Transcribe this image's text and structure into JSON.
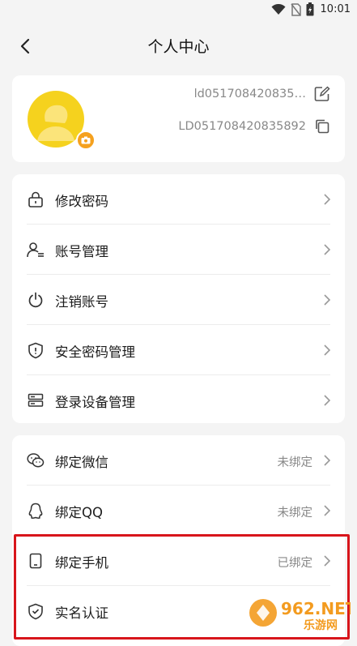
{
  "status": {
    "time": "10:01"
  },
  "header": {
    "title": "个人中心"
  },
  "profile": {
    "username": "ld051708420835…",
    "user_id": "LD051708420835892"
  },
  "menu1": [
    {
      "label": "修改密码",
      "icon": "lock-icon"
    },
    {
      "label": "账号管理",
      "icon": "user-manage-icon"
    },
    {
      "label": "注销账号",
      "icon": "power-icon"
    },
    {
      "label": "安全密码管理",
      "icon": "shield-icon"
    },
    {
      "label": "登录设备管理",
      "icon": "device-icon"
    }
  ],
  "menu2": [
    {
      "label": "绑定微信",
      "value": "未绑定",
      "icon": "wechat-icon"
    },
    {
      "label": "绑定QQ",
      "value": "未绑定",
      "icon": "qq-icon"
    },
    {
      "label": "绑定手机",
      "value": "已绑定",
      "icon": "phone-icon"
    },
    {
      "label": "实名认证",
      "value": "",
      "icon": "verify-shield-icon"
    }
  ],
  "watermark": {
    "text": "962.NET",
    "subtext": "乐游网"
  },
  "colors": {
    "accent": "#f5d21e",
    "highlight": "#d8151b"
  }
}
